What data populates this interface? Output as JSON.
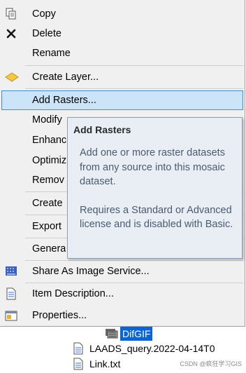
{
  "menu": {
    "items": [
      {
        "label": "Copy",
        "icon": "copy-icon"
      },
      {
        "label": "Delete",
        "icon": "delete-x-icon"
      },
      {
        "label": "Rename",
        "icon": ""
      },
      {
        "label": "Create Layer...",
        "icon": "layer-diamond-icon"
      },
      {
        "label": "Add Rasters...",
        "icon": ""
      },
      {
        "label": "Modify",
        "icon": ""
      },
      {
        "label": "Enhanc",
        "icon": ""
      },
      {
        "label": "Optimiz",
        "icon": ""
      },
      {
        "label": "Remov",
        "icon": ""
      },
      {
        "label": "Create",
        "icon": ""
      },
      {
        "label": "Export",
        "icon": ""
      },
      {
        "label": "Genera",
        "icon": ""
      },
      {
        "label": "Share As Image Service...",
        "icon": "image-service-icon"
      },
      {
        "label": "Item Description...",
        "icon": "document-icon"
      },
      {
        "label": "Properties...",
        "icon": "properties-icon"
      }
    ]
  },
  "tooltip": {
    "title": "Add Rasters",
    "paragraph1": "Add one or more raster datasets from any source into this mosaic dataset.",
    "paragraph2": "Requires a Standard or Advanced license and is disabled with Basic."
  },
  "tree": {
    "items": [
      {
        "label": "DifGIF",
        "icon": "mosaic-dataset-icon",
        "selected": true
      },
      {
        "label": "LAADS_query.2022-04-14T0",
        "icon": "file-icon",
        "selected": false
      },
      {
        "label": "Link.txt",
        "icon": "file-icon",
        "selected": false
      }
    ]
  },
  "watermark": "CSDN @疯狂学习GIS",
  "colors": {
    "menu_bg": "#f0f0f0",
    "highlight_bg": "#cce4f7",
    "highlight_border": "#3c8ecf",
    "tooltip_bg": "#e9eef5",
    "tooltip_text": "#4b5a70",
    "selection_bg": "#0a64d6"
  }
}
